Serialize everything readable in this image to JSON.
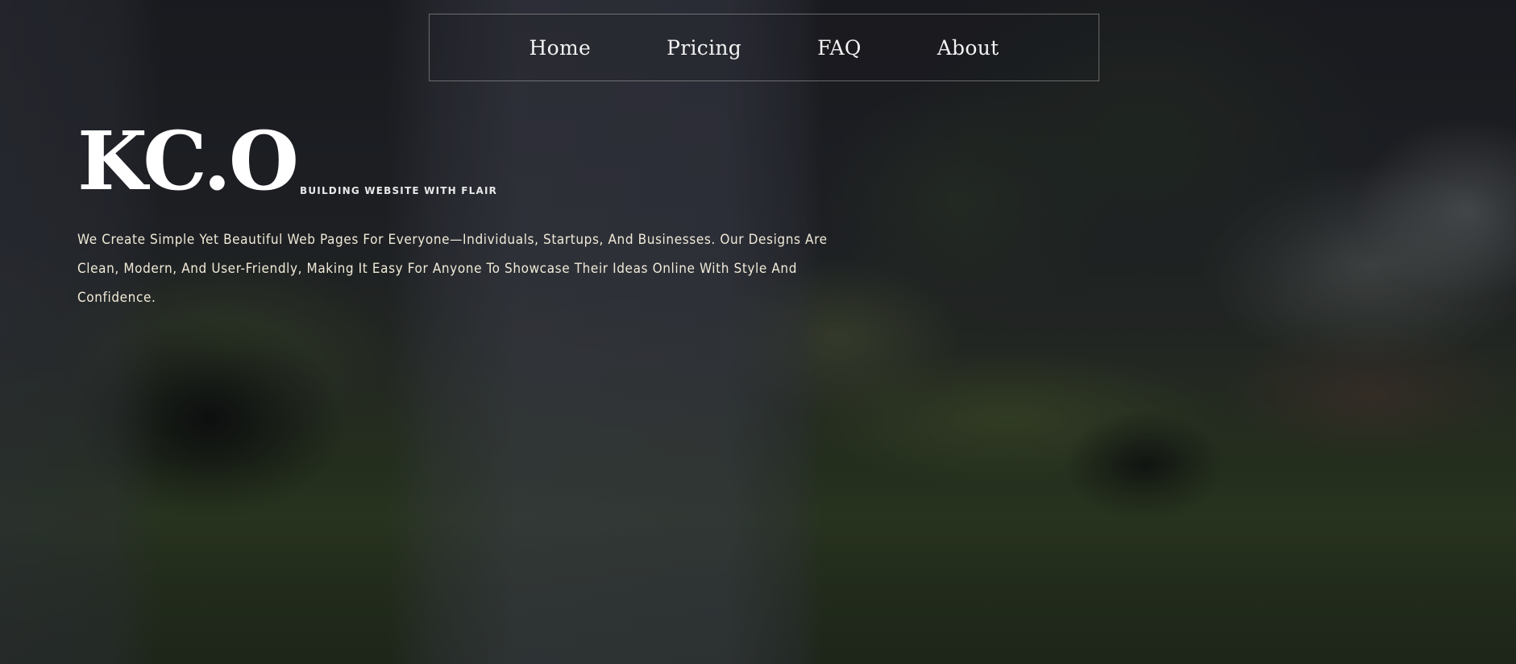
{
  "nav": {
    "items": [
      {
        "label": "Home"
      },
      {
        "label": "Pricing"
      },
      {
        "label": "FAQ"
      },
      {
        "label": "About"
      }
    ]
  },
  "brand": {
    "logo": "KC.O",
    "tagline": "BUILDING WEBSITE WITH FLAIR"
  },
  "hero": {
    "description": "We Create Simple Yet Beautiful Web Pages For Everyone—Individuals, Startups, And Businesses. Our Designs Are Clean, Modern, And User-Friendly, Making It Easy For Anyone To Showcase Their Ideas Online With Style And Confidence."
  },
  "colors": {
    "text_primary": "#ffffff",
    "text_description": "#f1ead8",
    "nav_border": "#c8c8c8"
  }
}
